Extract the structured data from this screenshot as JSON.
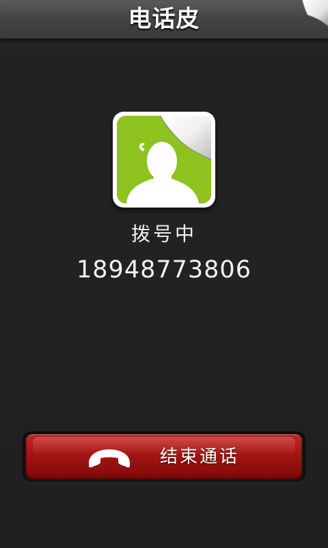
{
  "titlebar": {
    "title": "电话皮"
  },
  "call": {
    "status": "拨号中",
    "phone_number": "18948773806"
  },
  "actions": {
    "end_call_label": "结束通话"
  },
  "icons": {
    "page_curl": "page-curl-icon",
    "avatar": "contact-avatar-icon",
    "end_call": "phone-hangup-icon"
  },
  "colors": {
    "avatar_green": "#8dc21f",
    "end_call_red": "#a81616",
    "background": "#202020"
  }
}
